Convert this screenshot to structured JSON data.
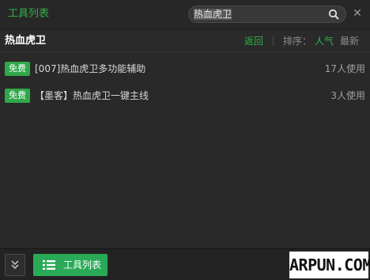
{
  "header": {
    "title": "工具列表",
    "search": {
      "value": "热血虎卫",
      "placeholder": ""
    },
    "close_glyph": "✕"
  },
  "section": {
    "title": "热血虎卫",
    "back_label": "返回",
    "sort_label": "排序：",
    "sort_popular": "人气",
    "sort_newest": "最新"
  },
  "items": [
    {
      "badge": "免费",
      "name": "[007]热血虎卫多功能辅助",
      "users": "17人使用"
    },
    {
      "badge": "免费",
      "name": "【墨客】热血虎卫一键主线",
      "users": "3人使用"
    }
  ],
  "footer": {
    "toollist_label": "工具列表"
  },
  "watermark": "ARPUN.COM",
  "colors": {
    "accent_green": "#2fb34b",
    "button_green": "#2aaa56",
    "background": "#292929"
  },
  "icons": {
    "search": "search-icon",
    "close": "close-icon",
    "collapse": "double-chevron-down-icon",
    "list": "list-icon"
  }
}
